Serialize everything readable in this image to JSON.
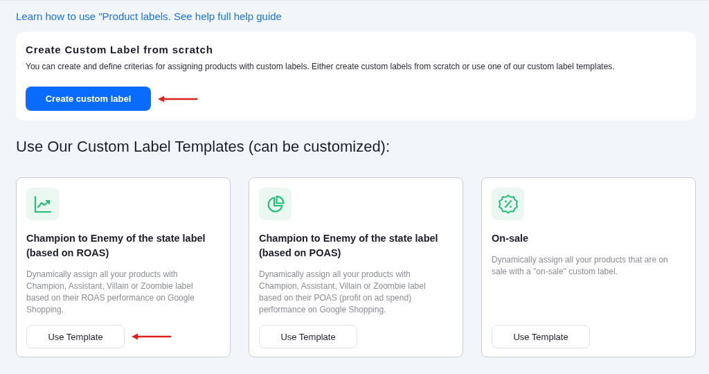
{
  "help_link": "Learn how to use \"Product labels. See help full help guide",
  "scratch_card": {
    "title": "Create Custom Label from scratch",
    "description": "You can create and define criterias for assigning products with custom labels. Either create custom labels from scratch or use one of our custom label templates.",
    "button": "Create custom label"
  },
  "templates_heading": "Use Our Custom Label Templates (can be customized):",
  "templates": [
    {
      "kind": "chart",
      "title": "Champion to Enemy of the state label (based on ROAS)",
      "description": "Dynamically assign all your products with Champion, Assistant, Villain or Zoombie label based on their ROAS performance on Google Shopping.",
      "button": "Use Template",
      "pointed": true
    },
    {
      "kind": "pie",
      "title": "Champion to Enemy of the state label (based on POAS)",
      "description": "Dynamically assign all your products with Champion, Assistant, Villain or Zoombie label based on their POAS (profit on ad spend) performance on Google Shopping.",
      "button": "Use Template",
      "pointed": false
    },
    {
      "kind": "discount",
      "title": "On-sale",
      "description": "Dynamically assign all your products that are on sale with a \"on-sale\" custom label.",
      "button": "Use Template",
      "pointed": false
    }
  ]
}
